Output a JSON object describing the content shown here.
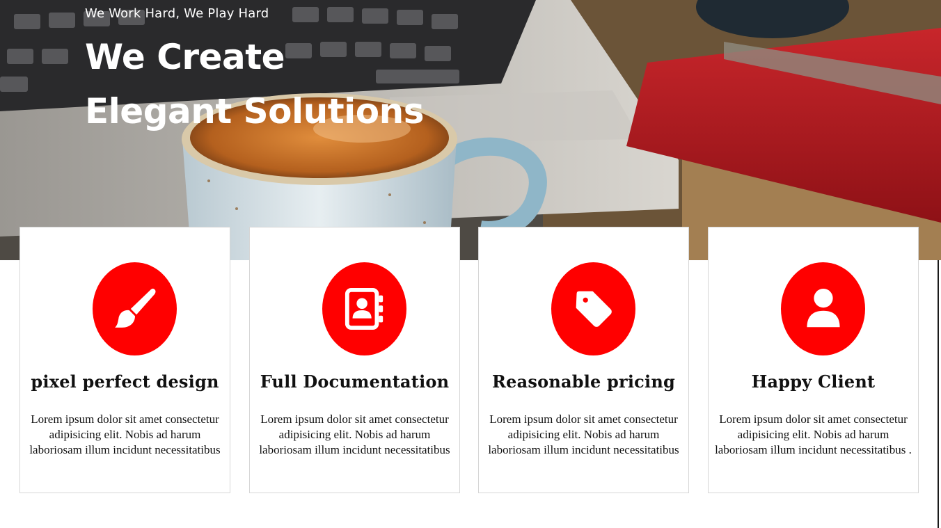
{
  "hero": {
    "tagline": "We Work Hard, We Play Hard",
    "headline_line1": "We Create",
    "headline_line2": "Elegant Solutions"
  },
  "accent_color": "#ff0000",
  "features": [
    {
      "icon": "paintbrush-icon",
      "title": "pixel perfect design",
      "text": "Lorem ipsum dolor sit amet consectetur adipisicing elit. Nobis ad harum laboriosam illum incidunt necessitatibus"
    },
    {
      "icon": "address-book-icon",
      "title": "Full Documentation",
      "text": "Lorem ipsum dolor sit amet consectetur adipisicing elit. Nobis ad harum laboriosam illum incidunt necessitatibus"
    },
    {
      "icon": "price-tag-icon",
      "title": "Reasonable pricing",
      "text": "Lorem ipsum dolor sit amet consectetur adipisicing elit. Nobis ad harum laboriosam illum incidunt necessitatibus"
    },
    {
      "icon": "user-icon",
      "title": "Happy Client",
      "text": "Lorem ipsum dolor sit amet consectetur adipisicing elit. Nobis ad harum laboriosam illum incidunt necessitatibus ."
    }
  ]
}
